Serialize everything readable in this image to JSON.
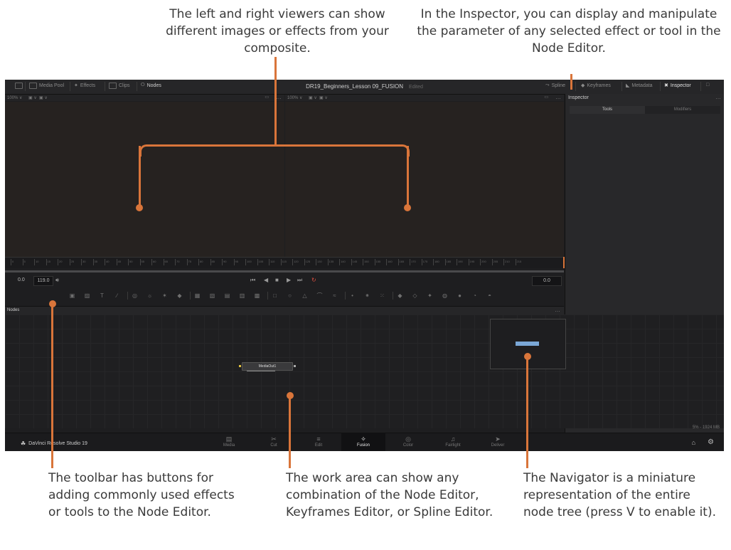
{
  "callouts": {
    "viewers": "The left and right viewers can show different images or effects from your composite.",
    "inspector": "In the Inspector, you can display and manipulate the parameter of any selected effect or tool in the Node Editor.",
    "toolbar": "The toolbar has buttons for adding commonly used effects or tools to the Node Editor.",
    "workarea": "The work area can show any combination of the Node Editor, Keyframes Editor, or Spline Editor.",
    "navigator": "The Navigator is a miniature representation of the entire node tree (press V to enable it)."
  },
  "topbar": {
    "left_items": [
      "Media Pool",
      "Effects",
      "Clips",
      "Nodes"
    ],
    "title": "DR19_Beginners_Lesson 09_FUSION",
    "edited": "Edited",
    "right_items": [
      "Spline",
      "Keyframes",
      "Metadata",
      "Inspector"
    ]
  },
  "viewer_bar": {
    "zoom_left": "100% ∨",
    "zoom_right": "100% ∨"
  },
  "inspector": {
    "title": "Inspector",
    "tabs": [
      "Tools",
      "Modifiers"
    ],
    "active_tab": "Tools"
  },
  "ruler": {
    "labels": [
      "0",
      "5",
      "10",
      "15",
      "20",
      "25",
      "30",
      "35",
      "40",
      "45",
      "50",
      "55",
      "60",
      "65",
      "70",
      "75",
      "80",
      "85",
      "90",
      "95",
      "100",
      "105",
      "110",
      "115",
      "120",
      "125",
      "130",
      "135",
      "140",
      "145",
      "150",
      "155",
      "160",
      "165",
      "170",
      "175",
      "180",
      "185",
      "190",
      "195",
      "200",
      "205",
      "210",
      "215"
    ]
  },
  "transport": {
    "start": "0.0",
    "end": "119.0",
    "current": "0.0"
  },
  "nodes": {
    "header": "Nodes",
    "node_label": "MediaOut1"
  },
  "memory": "5% - 1924 MB",
  "pagebar": {
    "brand": "DaVinci Resolve Studio 19",
    "pages": [
      "Media",
      "Cut",
      "Edit",
      "Fusion",
      "Color",
      "Fairlight",
      "Deliver"
    ],
    "active_page": "Fusion"
  },
  "colors": {
    "accent": "#d9753a",
    "app_bg": "#1e1e20",
    "navigator_rect": "#7aa7d6"
  }
}
